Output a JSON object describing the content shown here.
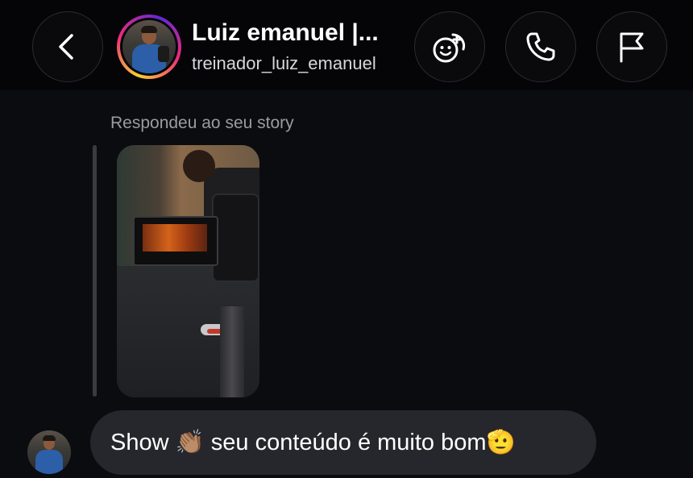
{
  "header": {
    "title": "Luiz emanuel |...",
    "username": "treinador_luiz_emanuel",
    "icons": {
      "back": "chevron-left-icon",
      "effects": "face-effects-icon",
      "call": "phone-icon",
      "report": "flag-icon"
    }
  },
  "conversation": {
    "story_reply_label": "Respondeu ao seu story",
    "message_text": "Show 👏🏽 seu conteúdo é muito bom🫡"
  },
  "colors": {
    "background": "#0b0c10",
    "header": "#050507",
    "bubble": "#26272c",
    "muted_text": "#9a9ca3"
  }
}
